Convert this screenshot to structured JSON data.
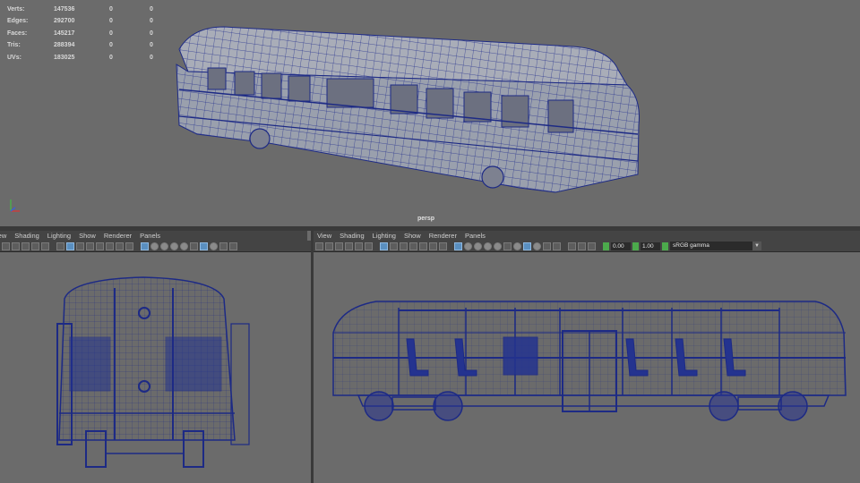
{
  "hud": {
    "rows": [
      {
        "label": "Verts:",
        "v1": "147536",
        "v2": "0",
        "v3": "0"
      },
      {
        "label": "Edges:",
        "v1": "292700",
        "v2": "0",
        "v3": "0"
      },
      {
        "label": "Faces:",
        "v1": "145217",
        "v2": "0",
        "v3": "0"
      },
      {
        "label": "Tris:",
        "v1": "288394",
        "v2": "0",
        "v3": "0"
      },
      {
        "label": "UVs:",
        "v1": "183025",
        "v2": "0",
        "v3": "0"
      }
    ]
  },
  "persp": {
    "camera_label": "persp"
  },
  "front_panel": {
    "menu": [
      "iew",
      "Shading",
      "Lighting",
      "Show",
      "Renderer",
      "Panels"
    ]
  },
  "side_panel": {
    "menu": [
      "View",
      "Shading",
      "Lighting",
      "Show",
      "Renderer",
      "Panels"
    ],
    "near_value": "0.00",
    "far_value": "1.00",
    "color_space": "sRGB gamma"
  },
  "colors": {
    "viewport_bg": "#6b6b6b",
    "wire": "#1d2a85",
    "mesh_fill": "#9aa0ad"
  }
}
